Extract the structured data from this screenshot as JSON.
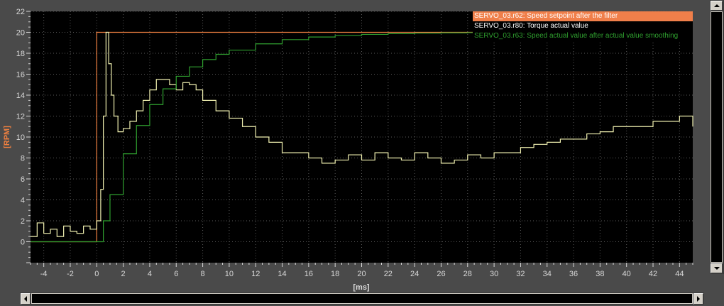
{
  "colors": {
    "background": "#4a4a4a",
    "plot_bg": "#000000",
    "grid": "#5a5a5a",
    "axis_text": "#d8d8d8",
    "ylabel": "#f08040",
    "setpoint": "#f08040",
    "torque": "#f0f0b0",
    "speed": "#2fa02f"
  },
  "legend": [
    {
      "label": "SERVO_03.r62: Speed setpoint after the filter",
      "color": "#ffffff",
      "active": true
    },
    {
      "label": "SERVO_03.r80: Torque actual value",
      "color": "#ffffff",
      "active": false
    },
    {
      "label": "SERVO_03.r63: Speed actual value after actual value smoothing",
      "color": "#2fa02f",
      "active": false
    }
  ],
  "icons": {
    "scroll_up": "triangle-up-icon",
    "scroll_down": "triangle-down-icon",
    "scroll_left": "triangle-left-icon",
    "scroll_right": "triangle-right-icon"
  },
  "chart_data": {
    "type": "line",
    "xlabel": "[ms]",
    "ylabel": "[RPM]",
    "xlim": [
      -5,
      45
    ],
    "ylim": [
      -2,
      22
    ],
    "xticks": [
      -4,
      -2,
      0,
      2,
      4,
      6,
      8,
      10,
      12,
      14,
      16,
      18,
      20,
      22,
      24,
      26,
      28,
      30,
      32,
      34,
      36,
      38,
      40,
      42,
      44
    ],
    "yticks": [
      0,
      2,
      4,
      6,
      8,
      10,
      12,
      14,
      16,
      18,
      20,
      22
    ],
    "grid": true,
    "legend_position": "top-right",
    "series": [
      {
        "name": "SERVO_03.r62: Speed setpoint after the filter",
        "color": "#f08040",
        "step": true,
        "x": [
          -5,
          0,
          0,
          45
        ],
        "y": [
          0,
          0,
          20,
          20
        ]
      },
      {
        "name": "SERVO_03.r80: Torque actual value",
        "color": "#f0f0b0",
        "step": true,
        "x": [
          -5,
          -4.5,
          -4,
          -3.5,
          -3,
          -2.5,
          -2,
          -1.5,
          -1,
          -0.5,
          0,
          0.3,
          0.5,
          0.7,
          0.9,
          1.1,
          1.3,
          1.6,
          2,
          2.5,
          3,
          3.5,
          4,
          4.5,
          5,
          5.5,
          6,
          6.5,
          7,
          7.5,
          8,
          8.5,
          9,
          9.5,
          10,
          11,
          12,
          13,
          14,
          15,
          16,
          17,
          18,
          19,
          20,
          21,
          22,
          23,
          24,
          25,
          26,
          27,
          28,
          29,
          30,
          31,
          32,
          33,
          34,
          35,
          36,
          37,
          38,
          39,
          40,
          41,
          42,
          43,
          44,
          45
        ],
        "y": [
          0.5,
          1.8,
          0.8,
          1.2,
          0.5,
          1.5,
          1.0,
          0.8,
          1.5,
          1.2,
          2.0,
          5,
          12,
          20,
          17,
          14,
          12,
          10.5,
          10.8,
          11.5,
          12.5,
          13.5,
          14.5,
          15.5,
          15.5,
          15,
          14.5,
          15.2,
          15,
          14.5,
          13.5,
          13.5,
          12.5,
          12.5,
          11.8,
          11,
          10,
          9.5,
          8.5,
          8.5,
          8.0,
          7.5,
          7.8,
          8.3,
          7.8,
          8.5,
          8.0,
          7.8,
          8.5,
          8.0,
          7.5,
          7.8,
          8.3,
          8.0,
          8.5,
          8.5,
          9.0,
          9.3,
          9.5,
          9.8,
          9.8,
          10.3,
          10.5,
          11.0,
          11.0,
          11.0,
          11.5,
          11.5,
          12.0,
          11.0
        ]
      },
      {
        "name": "SERVO_03.r63: Speed actual value after actual value smoothing",
        "color": "#2fa02f",
        "step": true,
        "x": [
          -5,
          0,
          0.5,
          1,
          2,
          3,
          4,
          5,
          6,
          7,
          8,
          9,
          10,
          12,
          14,
          16,
          18,
          20,
          22,
          24,
          26,
          28,
          30,
          35,
          40,
          45
        ],
        "y": [
          0,
          0,
          2,
          4.5,
          8.4,
          11.1,
          13.1,
          14.6,
          15.8,
          16.7,
          17.4,
          17.9,
          18.3,
          18.9,
          19.3,
          19.55,
          19.7,
          19.8,
          19.87,
          19.92,
          19.95,
          19.97,
          19.98,
          19.99,
          20,
          20
        ]
      }
    ]
  }
}
